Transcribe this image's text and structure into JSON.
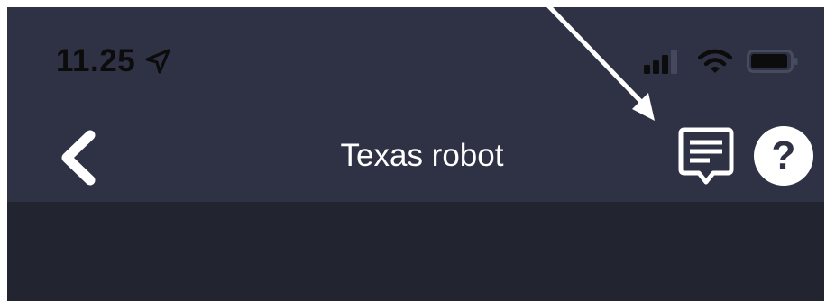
{
  "status_bar": {
    "time": "11.25",
    "location_icon": "location-arrow-icon",
    "signal_icon": "cellular-signal-icon",
    "wifi_icon": "wifi-icon",
    "battery_icon": "battery-icon"
  },
  "nav_bar": {
    "title": "Texas robot",
    "back_icon": "chevron-left-icon",
    "feedback_icon": "message-icon",
    "help_label": "?"
  },
  "annotation": {
    "icon": "pointer-arrow-icon"
  },
  "colors": {
    "header_bg": "#2f3244",
    "content_bg": "#22242f",
    "foreground": "#ffffff",
    "status_text": "#0c0c0c"
  }
}
